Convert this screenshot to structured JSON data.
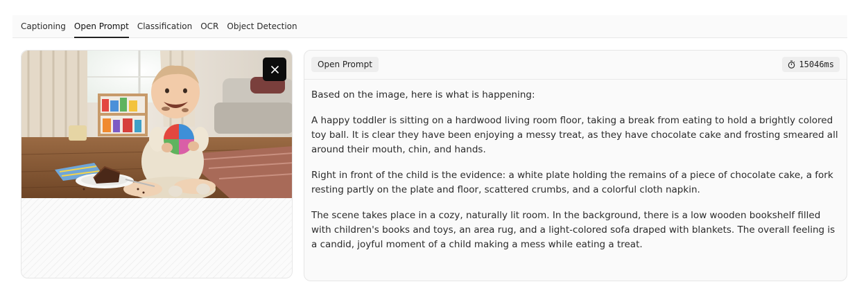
{
  "tabs": [
    {
      "label": "Captioning",
      "active": false
    },
    {
      "label": "Open Prompt",
      "active": true
    },
    {
      "label": "Classification",
      "active": false
    },
    {
      "label": "OCR",
      "active": false
    },
    {
      "label": "Object Detection",
      "active": false
    }
  ],
  "image_panel": {
    "close_icon": "x-icon"
  },
  "result": {
    "mode_label": "Open Prompt",
    "timer_icon": "stopwatch-icon",
    "elapsed": "15046ms",
    "paragraphs": [
      "Based on the image, here is what is happening:",
      "A happy toddler is sitting on a hardwood living room floor, taking a break from eating to hold a brightly colored toy ball. It is clear they have been enjoying a messy treat, as they have chocolate cake and frosting smeared all around their mouth, chin, and hands.",
      "Right in front of the child is the evidence: a white plate holding the remains of a piece of chocolate cake, a fork resting partly on the plate and floor, scattered crumbs, and a colorful cloth napkin.",
      "The scene takes place in a cozy, naturally lit room. In the background, there is a low wooden bookshelf filled with children's books and toys, an area rug, and a light-colored sofa draped with blankets. The overall feeling is a candid, joyful moment of a child making a mess while eating a treat."
    ]
  }
}
